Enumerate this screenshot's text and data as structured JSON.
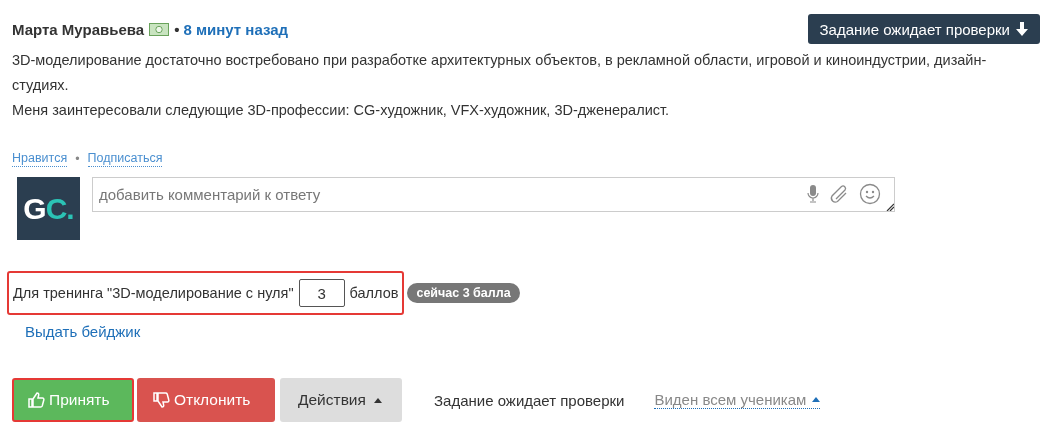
{
  "post": {
    "author": "Марта Муравьева",
    "separator": "•",
    "time": "8 минут назад",
    "status_button": "Задание ожидает проверки",
    "paragraphs": [
      "3D-моделирование достаточно востребовано при разработке архитектурных объектов, в рекламной области, игровой и киноиндустрии, дизайн-студиях.",
      "Меня заинтересовали следующие 3D-профессии: CG-художник, VFX-художник, 3D-дженералист."
    ]
  },
  "links": {
    "like": "Нравится",
    "separator": "•",
    "subscribe": "Подписаться"
  },
  "comment": {
    "avatar_letter": "G",
    "avatar_accent": "C.",
    "placeholder": "добавить комментарий к ответу"
  },
  "points": {
    "highlighted": true,
    "label": "Для тренинга \"3D-моделирование с нуля\"",
    "value": "3",
    "unit": "баллов",
    "badge": "сейчас 3 балла"
  },
  "badge_link": "Выдать бейджик",
  "actions": [
    {
      "kind": "accept",
      "label": "Принять",
      "highlighted": true
    },
    {
      "kind": "reject",
      "label": "Отклонить",
      "highlighted": false
    },
    {
      "kind": "menu",
      "label": "Действия",
      "highlighted": false
    }
  ],
  "status_text": "Задание ожидает проверки",
  "visibility": "Виден всем ученикам"
}
